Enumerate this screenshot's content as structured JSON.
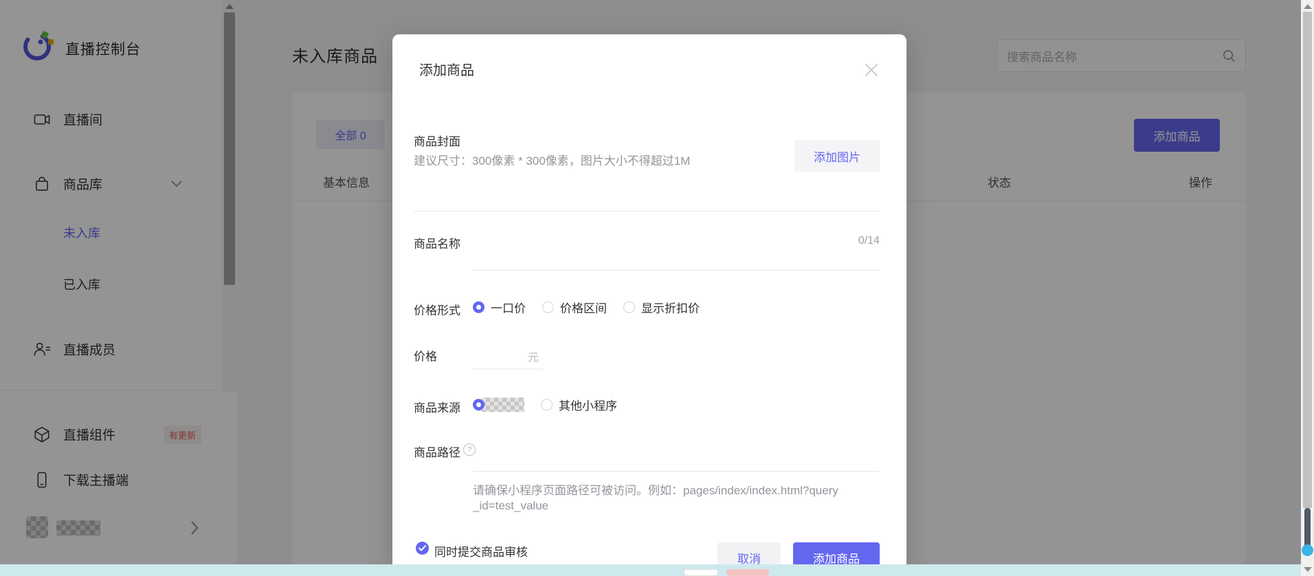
{
  "app": {
    "title": "直播控制台"
  },
  "sidebar": {
    "items": [
      {
        "label": "直播间"
      },
      {
        "label": "商品库"
      },
      {
        "label": "未入库",
        "active": true
      },
      {
        "label": "已入库"
      },
      {
        "label": "直播成员"
      },
      {
        "label": "直播组件",
        "badge": "有更新"
      },
      {
        "label": "下载主播端"
      }
    ]
  },
  "header": {
    "page_title": "未入库商品",
    "search_placeholder": "搜索商品名称"
  },
  "toolbar": {
    "tab_all": "全部 0",
    "add_product": "添加商品"
  },
  "table": {
    "columns": [
      "基本信息",
      "状态",
      "操作"
    ]
  },
  "modal": {
    "title": "添加商品",
    "cover": {
      "label": "商品封面",
      "hint": "建议尺寸：300像素 * 300像素，图片大小不得超过1M",
      "button": "添加图片"
    },
    "name": {
      "label": "商品名称",
      "counter": "0/14"
    },
    "price_type": {
      "label": "价格形式",
      "options": [
        "一口价",
        "价格区间",
        "显示折扣价"
      ],
      "selected": "一口价"
    },
    "price": {
      "label": "价格",
      "unit": "元"
    },
    "source": {
      "label": "商品来源",
      "option_other": "其他小程序"
    },
    "path": {
      "label": "商品路径",
      "hint_line1": "请确保小程序页面路径可被访问。例如：pages/index/index.html?query",
      "hint_line2": "_id=test_value"
    },
    "review_checkbox": "同时提交商品审核",
    "cancel": "取消",
    "submit": "添加商品"
  },
  "colors": {
    "accent_purple": "#6467F0",
    "badge_red": "#DE5A52",
    "taskbar_cyan": "#CEE9ED",
    "scroll_dot_blue": "#3CB4E6"
  }
}
